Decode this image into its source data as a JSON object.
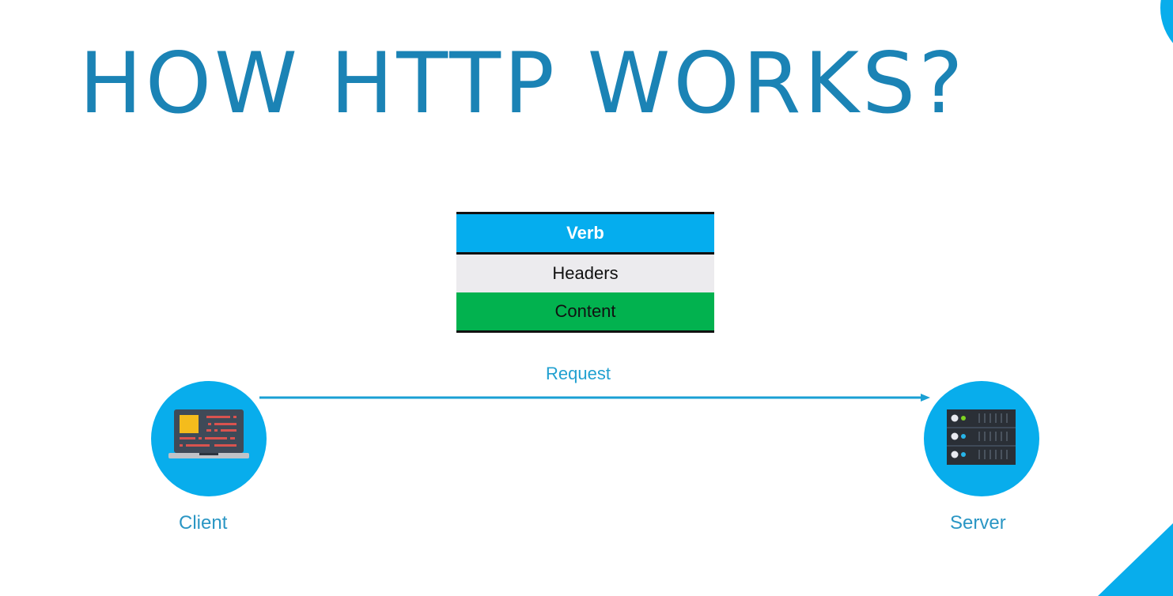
{
  "title": "HOW HTTP WORKS?",
  "packet": {
    "rows": [
      "Verb",
      "Headers",
      "Content"
    ]
  },
  "request_label": "Request",
  "client_label": "Client",
  "server_label": "Server",
  "colors": {
    "accent": "#08adec",
    "title": "#1b83b5",
    "verb": "#05adee",
    "headers": "#ecebee",
    "content": "#02b24f"
  }
}
